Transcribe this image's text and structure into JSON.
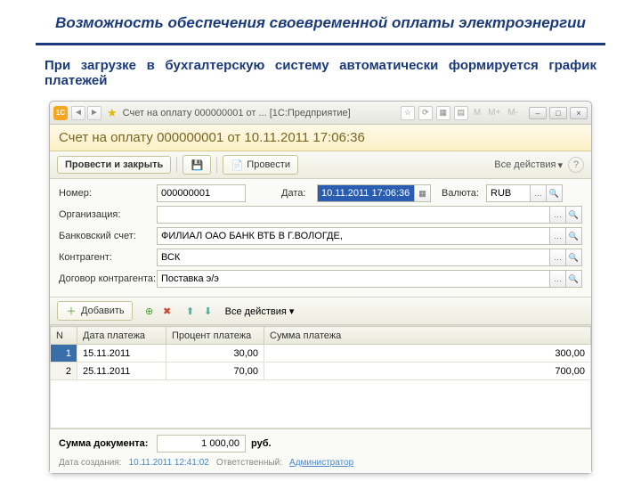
{
  "slide": {
    "title": "Возможность обеспечения своевременной оплаты электроэнергии",
    "subtitle": "При загрузке в бухгалтерскую систему автоматически формируется график платежей"
  },
  "titlebar": {
    "title": "Счет на оплату 000000001 от ... [1С:Предприятие]",
    "m1": "М",
    "m2": "М+",
    "m3": "М-"
  },
  "doc_header": "Счет на оплату 000000001 от 10.11.2011 17:06:36",
  "toolbar": {
    "post_close": "Провести и закрыть",
    "post": "Провести",
    "all_actions": "Все действия"
  },
  "form": {
    "number_label": "Номер:",
    "number_value": "000000001",
    "date_label": "Дата:",
    "date_value": "10.11.2011 17:06:36",
    "currency_label": "Валюта:",
    "currency_value": "RUB",
    "org_label": "Организация:",
    "org_value": "",
    "bank_label": "Банковский счет:",
    "bank_value": "ФИЛИАЛ ОАО БАНК ВТБ В Г.ВОЛОГДЕ,",
    "counterparty_label": "Контрагент:",
    "counterparty_value": "ВСК",
    "contract_label": "Договор контрагента:",
    "contract_value": "Поставка э/э"
  },
  "sub_toolbar": {
    "add": "Добавить",
    "all_actions": "Все действия"
  },
  "grid": {
    "headers": {
      "n": "N",
      "date": "Дата платежа",
      "percent": "Процент платежа",
      "sum": "Сумма платежа"
    },
    "rows": [
      {
        "n": "1",
        "date": "15.11.2011",
        "percent": "30,00",
        "sum": "300,00"
      },
      {
        "n": "2",
        "date": "25.11.2011",
        "percent": "70,00",
        "sum": "700,00"
      }
    ]
  },
  "footer": {
    "sum_label": "Сумма документа:",
    "sum_value": "1 000,00",
    "sum_unit": "руб.",
    "created_label": "Дата создания:",
    "created_value": "10.11.2011 12:41:02",
    "resp_label": "Ответственный:",
    "resp_value": "Администратор"
  }
}
